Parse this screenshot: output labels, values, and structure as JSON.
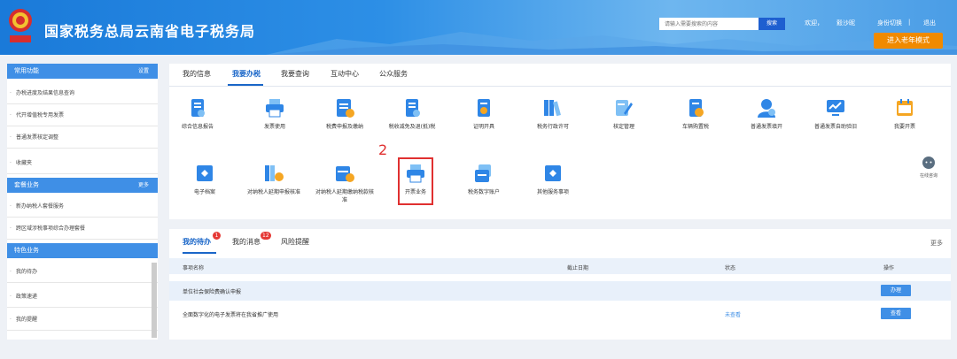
{
  "header": {
    "site_title": "国家税务总局云南省电子税务局",
    "search_placeholder": "请输入需要搜索的内容",
    "search_button": "搜索",
    "welcome": "欢迎，",
    "user_name": "縠沙昵",
    "switch_identity": "身份切换",
    "separator": "|",
    "logout": "退出",
    "mode_button": "进入老年模式"
  },
  "sidebar": {
    "common": {
      "title": "常用功能",
      "action": "设置"
    },
    "common_items": [
      "办税进度及结果信息查询",
      "代开增值税专用发票",
      "普通发票核定调整",
      "收藏夹"
    ],
    "package": {
      "title": "套餐业务",
      "action": "更多"
    },
    "package_items": [
      "新办纳税人套餐服务",
      "跨区域涉税事项综合办理套餐"
    ],
    "special": {
      "title": "特色业务"
    },
    "special_items": [
      "我的待办",
      "政策速递",
      "我的提醒"
    ]
  },
  "main_tabs": [
    "我的信息",
    "我要办税",
    "我要查询",
    "互动中心",
    "公众服务"
  ],
  "active_tab": "我要办税",
  "services_row1": [
    {
      "label": "综合信息报告",
      "icon": "report-icon"
    },
    {
      "label": "发票使用",
      "icon": "printer-icon"
    },
    {
      "label": "税费申报及缴纳",
      "icon": "declare-icon"
    },
    {
      "label": "税收减免及退(抵)税",
      "icon": "reduction-icon"
    },
    {
      "label": "证明开具",
      "icon": "certificate-icon"
    },
    {
      "label": "税务行政许可",
      "icon": "binders-icon"
    },
    {
      "label": "核定管理",
      "icon": "edit-icon"
    },
    {
      "label": "车辆购置税",
      "icon": "vehicle-icon"
    },
    {
      "label": "普通发票填开",
      "icon": "service-person-icon"
    },
    {
      "label": "普通发票自助验旧",
      "icon": "monitor-chart-icon"
    },
    {
      "label": "我要开票",
      "icon": "invoice-calendar-icon"
    }
  ],
  "services_row2": [
    {
      "label": "电子档案",
      "icon": "archive-icon"
    },
    {
      "label": "对纳税人延期申报核准",
      "icon": "binders-icon"
    },
    {
      "label": "对纳税人延期缴纳税款核准",
      "icon": "calendar-clock-icon"
    },
    {
      "label": "开票业务",
      "icon": "printer-icon"
    },
    {
      "label": "税务数字账户",
      "icon": "digital-account-icon"
    },
    {
      "label": "其他服务事项",
      "icon": "folder-icon"
    }
  ],
  "annotation": {
    "step_number": "2"
  },
  "float_help": {
    "label": "在线咨询",
    "icon": "chat-bot-icon"
  },
  "bottom_tabs": [
    {
      "label": "我的待办",
      "badge": "1"
    },
    {
      "label": "我的消息",
      "badge": "12"
    },
    {
      "label": "风险提醒",
      "badge": ""
    }
  ],
  "more_link": "更多",
  "table": {
    "headers": [
      "事项名称",
      "截止日期",
      "状态",
      "操作"
    ],
    "rows": [
      {
        "name": "单位社会保险费确认申报",
        "deadline": "",
        "status": "",
        "action": "办理"
      },
      {
        "name": "全面数字化的电子发票将在我省推广使用",
        "deadline": "",
        "status": "未查看",
        "action": "查看"
      }
    ]
  },
  "colors": {
    "brand_blue": "#1a66c8",
    "header_blue": "#2d8fe6",
    "accent_orange": "#f08a00",
    "highlight_red": "#e03030"
  }
}
